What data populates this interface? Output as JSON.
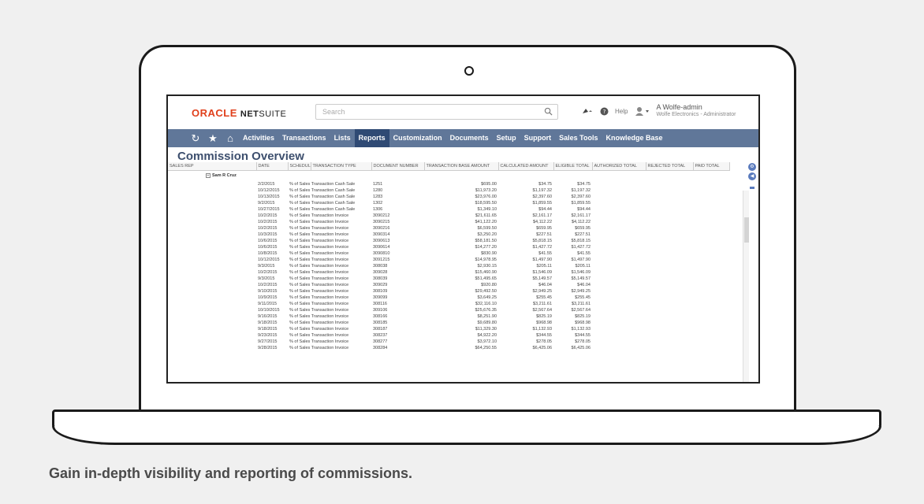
{
  "header": {
    "logo_oracle": "ORACLE",
    "logo_net": "NET",
    "logo_suite": "SUITE",
    "search_placeholder": "Search",
    "help_label": "Help",
    "user_name": "A Wolfe-admin",
    "user_role": "Wolfe Electronics - Administrator"
  },
  "nav": {
    "items": [
      {
        "label": "Activities"
      },
      {
        "label": "Transactions"
      },
      {
        "label": "Lists"
      },
      {
        "label": "Reports"
      },
      {
        "label": "Customization"
      },
      {
        "label": "Documents"
      },
      {
        "label": "Setup"
      },
      {
        "label": "Support"
      },
      {
        "label": "Sales Tools"
      },
      {
        "label": "Knowledge Base"
      }
    ],
    "active": "Reports"
  },
  "page": {
    "title": "Commission Overview"
  },
  "table": {
    "columns": [
      "SALES REP",
      "DATE",
      "SCHEDULE",
      "TRANSACTION TYPE",
      "DOCUMENT NUMBER",
      "TRANSACTION BASE AMOUNT",
      "CALCULATED AMOUNT",
      "ELIGIBLE TOTAL",
      "AUTHORIZED TOTAL",
      "REJECTED TOTAL",
      "PAID TOTAL"
    ],
    "rep": "Sam R Cruz",
    "rows": [
      [
        "2/2/2015",
        "% of Sales",
        "Transaction Cash Sale",
        "1251",
        "$695.00",
        "$34.75",
        "$34.75"
      ],
      [
        "10/12/2015",
        "% of Sales",
        "Transaction Cash Sale",
        "1280",
        "$11,973.20",
        "$1,197.32",
        "$1,197.32"
      ],
      [
        "10/13/2015",
        "% of Sales",
        "Transaction Cash Sale",
        "1283",
        "$23,976.00",
        "$2,397.60",
        "$2,397.60"
      ],
      [
        "9/2/2015",
        "% of Sales",
        "Transaction Cash Sale",
        "1302",
        "$18,595.50",
        "$1,859.55",
        "$1,859.55"
      ],
      [
        "10/27/2015",
        "% of Sales",
        "Transaction Cash Sale",
        "1306",
        "$1,349.10",
        "$94.44",
        "$94.44"
      ],
      [
        "10/2/2015",
        "% of Sales",
        "Transaction Invoice",
        "3090212",
        "$21,611.65",
        "$2,161.17",
        "$2,161.17"
      ],
      [
        "10/2/2015",
        "% of Sales",
        "Transaction Invoice",
        "3090215",
        "$41,122.20",
        "$4,112.22",
        "$4,112.22"
      ],
      [
        "10/2/2015",
        "% of Sales",
        "Transaction Invoice",
        "3090216",
        "$6,599.50",
        "$659.95",
        "$659.95"
      ],
      [
        "10/3/2015",
        "% of Sales",
        "Transaction Invoice",
        "3090314",
        "$3,250.20",
        "$227.51",
        "$227.51"
      ],
      [
        "10/6/2015",
        "% of Sales",
        "Transaction Invoice",
        "3090613",
        "$58,181.50",
        "$5,818.15",
        "$5,818.15"
      ],
      [
        "10/6/2015",
        "% of Sales",
        "Transaction Invoice",
        "3090614",
        "$14,277.20",
        "$1,427.72",
        "$1,427.72"
      ],
      [
        "10/8/2015",
        "% of Sales",
        "Transaction Invoice",
        "3090810",
        "$830.90",
        "$41.55",
        "$41.55"
      ],
      [
        "10/12/2015",
        "% of Sales",
        "Transaction Invoice",
        "3091215",
        "$14,978.95",
        "$1,497.90",
        "$1,497.90"
      ],
      [
        "9/3/2015",
        "% of Sales",
        "Transaction Invoice",
        "308038",
        "$2,930.15",
        "$205.11",
        "$205.11"
      ],
      [
        "10/2/2015",
        "% of Sales",
        "Transaction Invoice",
        "309028",
        "$15,460.90",
        "$1,546.09",
        "$1,546.09"
      ],
      [
        "9/3/2015",
        "% of Sales",
        "Transaction Invoice",
        "308039",
        "$51,495.65",
        "$5,149.57",
        "$5,149.57"
      ],
      [
        "10/2/2015",
        "% of Sales",
        "Transaction Invoice",
        "309029",
        "$920.80",
        "$46.04",
        "$46.04"
      ],
      [
        "9/10/2015",
        "% of Sales",
        "Transaction Invoice",
        "308109",
        "$29,492.50",
        "$2,949.25",
        "$2,949.25"
      ],
      [
        "10/9/2015",
        "% of Sales",
        "Transaction Invoice",
        "309099",
        "$3,649.25",
        "$255.45",
        "$255.45"
      ],
      [
        "9/11/2015",
        "% of Sales",
        "Transaction Invoice",
        "308116",
        "$32,116.10",
        "$3,211.61",
        "$3,211.61"
      ],
      [
        "10/10/2015",
        "% of Sales",
        "Transaction Invoice",
        "309106",
        "$25,676.35",
        "$2,567.64",
        "$2,567.64"
      ],
      [
        "9/16/2015",
        "% of Sales",
        "Transaction Invoice",
        "308166",
        "$8,251.90",
        "$825.19",
        "$825.19"
      ],
      [
        "9/18/2015",
        "% of Sales",
        "Transaction Invoice",
        "308185",
        "$9,689.80",
        "$968.98",
        "$968.98"
      ],
      [
        "9/18/2015",
        "% of Sales",
        "Transaction Invoice",
        "308187",
        "$11,329.30",
        "$1,132.93",
        "$1,132.93"
      ],
      [
        "9/23/2015",
        "% of Sales",
        "Transaction Invoice",
        "308237",
        "$4,922.20",
        "$344.55",
        "$344.55"
      ],
      [
        "9/27/2015",
        "% of Sales",
        "Transaction Invoice",
        "308277",
        "$3,972.10",
        "$278.05",
        "$278.05"
      ],
      [
        "9/28/2015",
        "% of Sales",
        "Transaction Invoice",
        "308284",
        "$64,250.55",
        "$6,425.06",
        "$6,425.06"
      ]
    ]
  },
  "caption": "Gain in-depth visibility and reporting of commissions.",
  "colors": {
    "nav_bg": "#607799",
    "nav_active": "#2f4a74",
    "oracle_red": "#e0401c",
    "title_blue": "#3d4f6e"
  }
}
